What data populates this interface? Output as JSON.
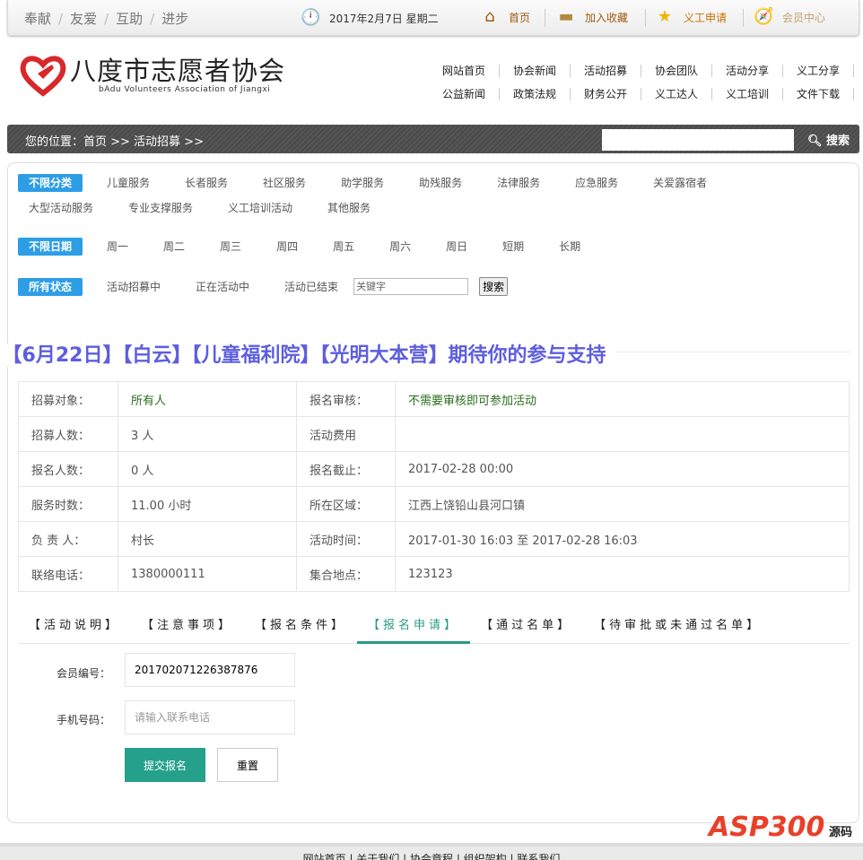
{
  "topbar": {
    "slogans": [
      "奉献",
      "友爱",
      "互助",
      "进步"
    ],
    "date": "2017年2月7日 星期二",
    "links": [
      {
        "label": "首页",
        "icon": "home-icon"
      },
      {
        "label": "加入收藏",
        "icon": "folder-icon"
      },
      {
        "label": "义工申请",
        "icon": "star-icon"
      },
      {
        "label": "会员中心",
        "icon": "compass-icon"
      }
    ]
  },
  "logo": {
    "cn": "八度市志愿者协会",
    "en": "bAdu Volunteers Association of Jiangxi"
  },
  "nav": {
    "row1": [
      "网站首页",
      "协会新闻",
      "活动招募",
      "协会团队",
      "活动分享",
      "义工分享"
    ],
    "row2": [
      "公益新闻",
      "政策法规",
      "财务公开",
      "义工达人",
      "义工培训",
      "文件下载"
    ]
  },
  "breadcrumb": {
    "text": "您的位置：首页 >> 活动招募 >>",
    "search_label": "搜索"
  },
  "filters": {
    "category": [
      "不限分类",
      "儿童服务",
      "长者服务",
      "社区服务",
      "助学服务",
      "助残服务",
      "法律服务",
      "应急服务",
      "关爱露宿者",
      "大型活动服务",
      "专业支撑服务",
      "义工培训活动",
      "其他服务"
    ],
    "date": [
      "不限日期",
      "周一",
      "周二",
      "周三",
      "周四",
      "周五",
      "周六",
      "周日",
      "短期",
      "长期"
    ],
    "status": [
      "所有状态",
      "活动招募中",
      "正在活动中",
      "活动已结束"
    ],
    "keyword_placeholder": "关键字",
    "search_button": "搜索"
  },
  "activity": {
    "title": "【6月22日】【白云】【儿童福利院】【光明大本营】期待你的参与支持",
    "rows": [
      [
        "招募对象：",
        "所有人",
        "报名审核：",
        "不需要审核即可参加活动"
      ],
      [
        "招募人数：",
        "3 人",
        "活动费用",
        ""
      ],
      [
        "报名人数：",
        "0 人",
        "报名截止：",
        "2017-02-28 00:00"
      ],
      [
        "服务时数：",
        "11.00 小时",
        "所在区域：",
        "江西上饶铅山县河口镇"
      ],
      [
        "负 责 人：",
        "村长",
        "活动时间：",
        "2017-01-30 16:03 至 2017-02-28 16:03"
      ],
      [
        "联络电话：",
        "1380000111",
        "集合地点：",
        "123123"
      ]
    ]
  },
  "tabs": [
    "【活动说明】",
    "【注意事项】",
    "【报名条件】",
    "【报名申请】",
    "【通过名单】",
    "【待审批或未通过名单】"
  ],
  "form": {
    "member_label": "会员编号：",
    "member_value": "201702071226387876",
    "phone_label": "手机号码：",
    "phone_placeholder": "请输入联系电话",
    "submit": "提交报名",
    "reset": "重置"
  },
  "footer": {
    "links": [
      "网站首页",
      "关于我们",
      "协会章程",
      "组织架构",
      "联系我们"
    ]
  },
  "watermark": {
    "text": "ASP300",
    "sub": "源码 .com"
  },
  "colors": {
    "accent_blue": "#2d9ee6",
    "title": "#5d5ee0",
    "active_tab": "#2a9a88",
    "submit": "#25a08b"
  }
}
